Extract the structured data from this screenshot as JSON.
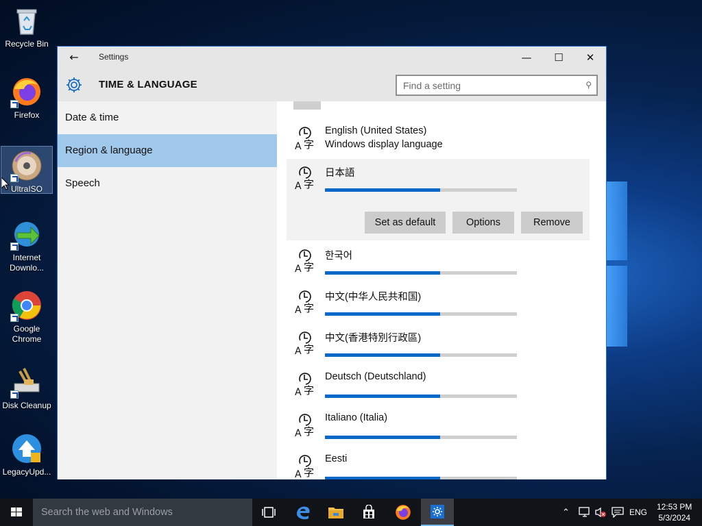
{
  "desktop": {
    "icons": [
      {
        "label": "Recycle Bin"
      },
      {
        "label": "Firefox"
      },
      {
        "label": "UltraISO"
      },
      {
        "label": "Internet Downlo..."
      },
      {
        "label": "Google Chrome"
      },
      {
        "label": "Disk Cleanup"
      },
      {
        "label": "LegacyUpd..."
      }
    ]
  },
  "window": {
    "title": "Settings",
    "back_icon": "back-arrow-icon",
    "minimize_glyph": "—",
    "maximize_glyph": "☐",
    "close_glyph": "✕",
    "header_title": "TIME & LANGUAGE",
    "search_placeholder": "Find a setting"
  },
  "sidebar": {
    "items": [
      {
        "label": "Date & time",
        "active": false
      },
      {
        "label": "Region & language",
        "active": true
      },
      {
        "label": "Speech",
        "active": false
      }
    ]
  },
  "languages": [
    {
      "name": "English (United States)",
      "sub": "Windows display language",
      "progress": null
    },
    {
      "name": "日本語",
      "progress": 0.6,
      "selected": true
    },
    {
      "name": "한국어",
      "progress": 0.6
    },
    {
      "name": "中文(中华人民共和国)",
      "progress": 0.6
    },
    {
      "name": "中文(香港特別行政區)",
      "progress": 0.6
    },
    {
      "name": "Deutsch (Deutschland)",
      "progress": 0.6
    },
    {
      "name": "Italiano (Italia)",
      "progress": 0.6
    },
    {
      "name": "Eesti",
      "progress": 0.6
    }
  ],
  "actions": {
    "set_default": "Set as default",
    "options": "Options",
    "remove": "Remove"
  },
  "taskbar": {
    "search_placeholder": "Search the web and Windows",
    "language": "ENG",
    "time": "12:53 PM",
    "date": "5/3/2024"
  },
  "colors": {
    "accent": "#0a68c8",
    "selected_nav": "#9fc8ea",
    "window_chrome": "#e6e6e6"
  }
}
